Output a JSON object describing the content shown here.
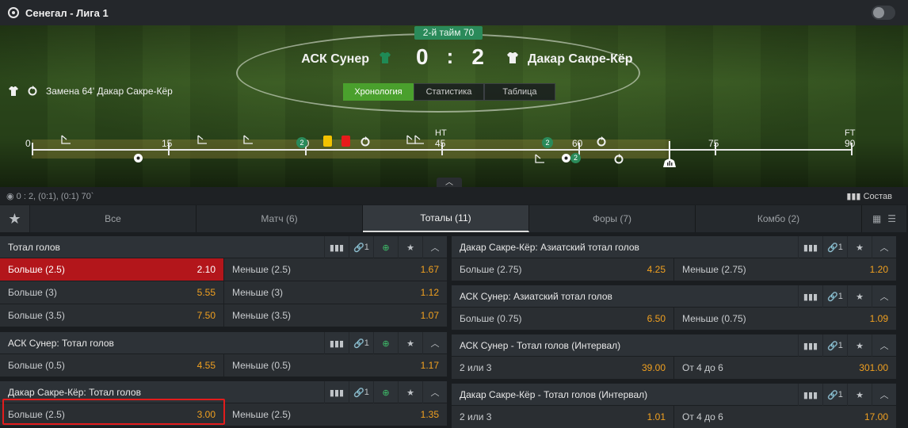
{
  "header": {
    "title": "Сенегал - Лига 1"
  },
  "scoreboard": {
    "period": "2-й тайм 70",
    "home_team": "АСК Сунер",
    "away_team": "Дакар Сакре-Кёр",
    "home_score": "0",
    "away_score": "2",
    "separator": ":",
    "home_shirt_color": "#1f8a55",
    "away_shirt_color": "#f0f0f0"
  },
  "last_event": "Замена 64' Дакар Сакре-Кёр",
  "view_tabs": [
    "Хронология",
    "Статистика",
    "Таблица"
  ],
  "timeline": {
    "ticks": [
      "0",
      "15",
      "30",
      "45",
      "60",
      "75",
      "90"
    ],
    "top_labels": {
      "ht": "HT",
      "ft": "FT"
    },
    "goal_count_1": "2",
    "goal_count_2": "2",
    "goal_count_3": "2",
    "yellow_card_color": "#f2c200",
    "red_card_color": "#e61b1b"
  },
  "subbar": {
    "score_summary": "0 : 2, (0:1), (0:1) 70`",
    "lineups": "Состав"
  },
  "market_tabs": [
    "Все",
    "Матч (6)",
    "Тоталы (11)",
    "Форы (7)",
    "Комбо (2)"
  ],
  "panel_link_count": "1",
  "markets_left": [
    {
      "title": "Тотал голов",
      "rows": [
        [
          {
            "label": "Больше (2.5)",
            "odd": "2.10"
          },
          {
            "label": "Меньше (2.5)",
            "odd": "1.67"
          }
        ],
        [
          {
            "label": "Больше (3)",
            "odd": "5.55"
          },
          {
            "label": "Меньше (3)",
            "odd": "1.12"
          }
        ],
        [
          {
            "label": "Больше (3.5)",
            "odd": "7.50"
          },
          {
            "label": "Меньше (3.5)",
            "odd": "1.07"
          }
        ]
      ]
    },
    {
      "title": "АСК Сунер: Тотал голов",
      "rows": [
        [
          {
            "label": "Больше (0.5)",
            "odd": "4.55"
          },
          {
            "label": "Меньше (0.5)",
            "odd": "1.17"
          }
        ]
      ]
    },
    {
      "title": "Дакар Сакре-Кёр: Тотал голов",
      "rows": [
        [
          {
            "label": "Больше (2.5)",
            "odd": "3.00"
          },
          {
            "label": "Меньше (2.5)",
            "odd": "1.35"
          }
        ]
      ]
    }
  ],
  "markets_right": [
    {
      "title": "Дакар Сакре-Кёр: Азиатский тотал голов",
      "rows": [
        [
          {
            "label": "Больше (2.75)",
            "odd": "4.25"
          },
          {
            "label": "Меньше (2.75)",
            "odd": "1.20"
          }
        ]
      ]
    },
    {
      "title": "АСК Сунер: Азиатский тотал голов",
      "rows": [
        [
          {
            "label": "Больше (0.75)",
            "odd": "6.50"
          },
          {
            "label": "Меньше (0.75)",
            "odd": "1.09"
          }
        ]
      ]
    },
    {
      "title": "АСК Сунер - Тотал голов (Интервал)",
      "rows": [
        [
          {
            "label": "2 или 3",
            "odd": "39.00"
          },
          {
            "label": "От 4 до 6",
            "odd": "301.00"
          }
        ]
      ]
    },
    {
      "title": "Дакар Сакре-Кёр - Тотал голов (Интервал)",
      "rows": [
        [
          {
            "label": "2 или 3",
            "odd": "1.01"
          },
          {
            "label": "От 4 до 6",
            "odd": "17.00"
          }
        ]
      ]
    }
  ],
  "colors": {
    "accent_green": "#4aa02d",
    "selected_red": "#b3161b",
    "odd_orange": "#f0a020",
    "highlight_box": "#e21c1c"
  }
}
